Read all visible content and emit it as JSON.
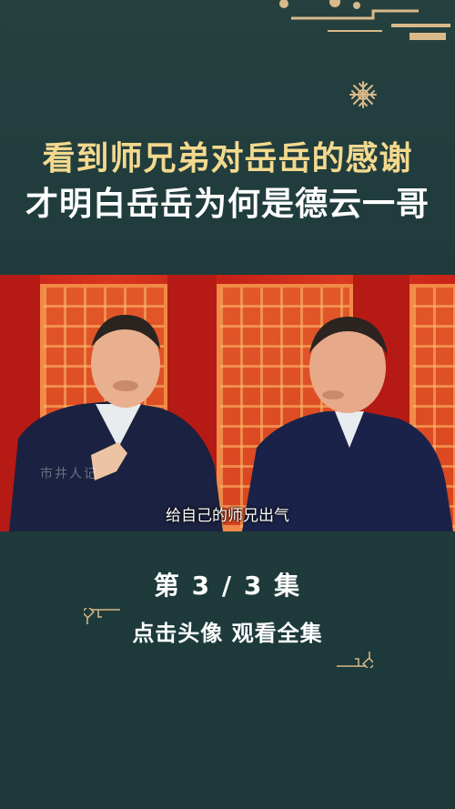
{
  "title": {
    "line1": "看到师兄弟对岳岳的感谢",
    "line2": "才明白岳岳为何是德云一哥"
  },
  "video": {
    "subtitle": "给自己的师兄出气",
    "watermark": "市井人记"
  },
  "episode_label": "第 3 / 3 集",
  "cta_label": "点击头像 观看全集",
  "colors": {
    "background": "#1f3b3c",
    "title_line1": "#f3d98e",
    "title_line2": "#ffffff",
    "stage_red": "#c7201a",
    "ornament": "#d9b98a"
  },
  "icons": [
    "snowflake-ornament-icon",
    "frame-corner-icon"
  ]
}
